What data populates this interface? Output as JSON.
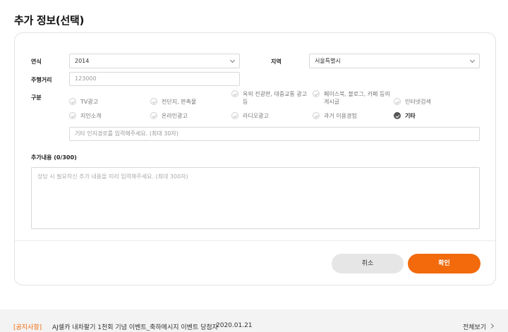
{
  "page_title": "추가 정보(선택)",
  "form": {
    "year_label": "연식",
    "year_value": "2014",
    "region_label": "지역",
    "region_value": "서울특별시",
    "mileage_label": "주행거리",
    "mileage_placeholder": "123000",
    "source_label": "구분",
    "source_options": [
      {
        "label": "TV광고",
        "checked": false
      },
      {
        "label": "전단지, 판촉물",
        "checked": false
      },
      {
        "label": "옥외 전광판, 대중교통 광고 등",
        "checked": false
      },
      {
        "label": "페이스북, 블로그, 카페 등의 게시글",
        "checked": false
      },
      {
        "label": "인터넷검색",
        "checked": false
      },
      {
        "label": "지인소개",
        "checked": false
      },
      {
        "label": "온라인광고",
        "checked": false
      },
      {
        "label": "라디오광고",
        "checked": false
      },
      {
        "label": "과거 이용경험",
        "checked": false
      },
      {
        "label": "기타",
        "checked": true
      }
    ],
    "other_placeholder": "기타 인지경로를 입력해주세요. (최대 30자)",
    "content_label": "추가내용 (0/300)",
    "content_placeholder": "상담 시 필요하신 추가 내용을 미리 입력해주세요. (최대 300자)"
  },
  "buttons": {
    "cancel": "취소",
    "confirm": "확인"
  },
  "notice": {
    "tag": "[공지사항]",
    "text": "AJ셀카 내차팔기 1천회 기념 이벤트_축하메시지 이벤트 당첨자",
    "date": "2020.01.21",
    "view_all": "전체보기"
  },
  "colors": {
    "accent": "#f26a0c",
    "cancel_bg": "#e6e6e6",
    "notice_bg": "#f3f3f3"
  }
}
